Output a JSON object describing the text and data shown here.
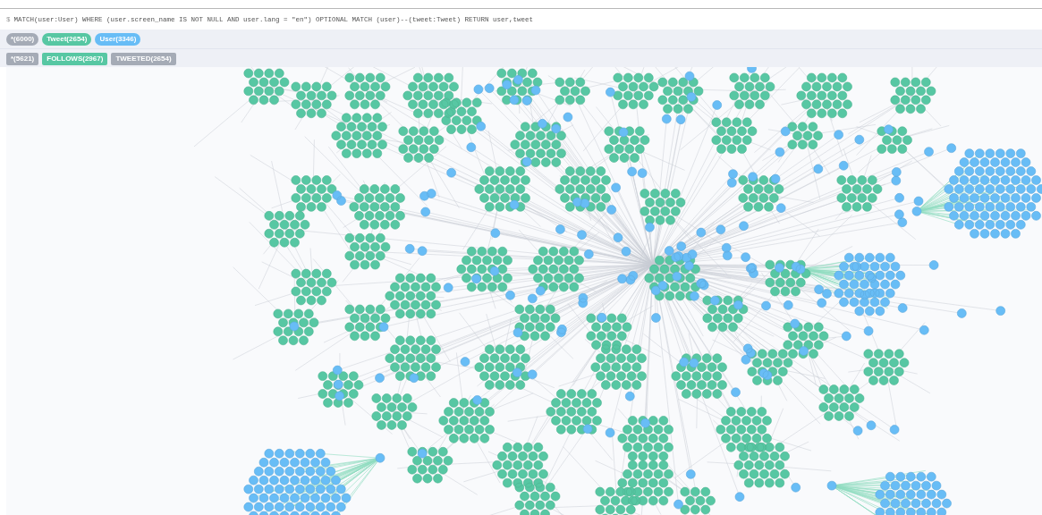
{
  "query": {
    "prompt": "$",
    "text": "MATCH(user:User) WHERE (user.screen_name IS NOT NULL AND user.lang = \"en\") OPTIONAL MATCH (user)--(tweet:Tweet) RETURN user,tweet"
  },
  "node_labels": [
    {
      "label": "*(6000)",
      "color": "#a5abb6"
    },
    {
      "label": "Tweet(2654)",
      "color": "#57c7a3"
    },
    {
      "label": "User(3346)",
      "color": "#68bdf6"
    }
  ],
  "relationship_types": [
    {
      "label": "*(5621)",
      "color": "#a5abb6"
    },
    {
      "label": "FOLLOWS(2967)",
      "color": "#57c7a3"
    },
    {
      "label": "TWEETED(2654)",
      "color": "#a5abb6"
    }
  ]
}
